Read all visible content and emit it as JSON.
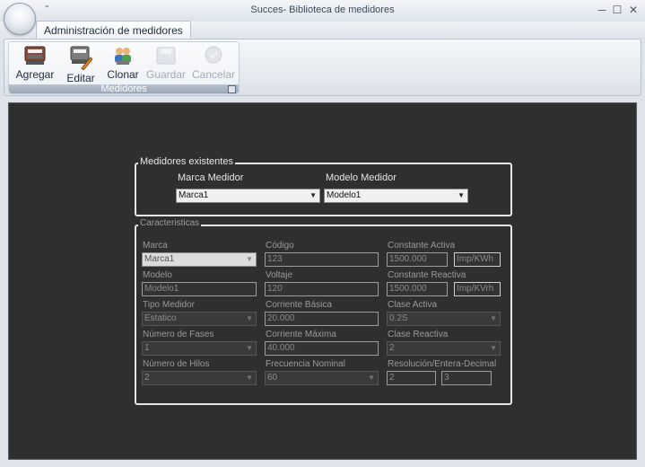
{
  "window": {
    "title": "Succes- Biblioteca de medidores",
    "qat_glyph": "⁼",
    "minimize_glyph": "─",
    "maximize_glyph": "☐",
    "close_glyph": "✕"
  },
  "ribbon": {
    "tab_label": "Administración de medidores",
    "group_label": "Medidores",
    "buttons": {
      "agregar": "Agregar",
      "editar": "Editar",
      "clonar": "Clonar",
      "guardar": "Guardar",
      "cancelar": "Cancelar"
    }
  },
  "existentes": {
    "legend": "Medidores existentes",
    "marca_label": "Marca Medidor",
    "marca_value": "Marca1",
    "modelo_label": "Modelo Medidor",
    "modelo_value": "Modelo1"
  },
  "caracteristicas": {
    "legend": "Caracteristicas",
    "marca_label": "Marca",
    "marca_value": "Marca1",
    "codigo_label": "Código",
    "codigo_value": "123",
    "const_activa_label": "Constante Activa",
    "const_activa_value": "1500.000",
    "const_activa_unit": "Imp/KWh",
    "modelo_label": "Modelo",
    "modelo_value": "Modelo1",
    "voltaje_label": "Voltaje",
    "voltaje_value": "120",
    "const_reactiva_label": "Constante Reactiva",
    "const_reactiva_value": "1500.000",
    "const_reactiva_unit": "Imp/KVrh",
    "tipo_label": "Tipo Medidor",
    "tipo_value": "Estatico",
    "corr_basica_label": "Corriente Básica",
    "corr_basica_value": "20.000",
    "clase_activa_label": "Clase Activa",
    "clase_activa_value": "0.2S",
    "fases_label": "Número de Fases",
    "fases_value": "1",
    "corr_max_label": "Corriente Máxima",
    "corr_max_value": "40.000",
    "clase_reactiva_label": "Clase Reactiva",
    "clase_reactiva_value": "2",
    "hilos_label": "Número de Hilos",
    "hilos_value": "2",
    "frecuencia_label": "Frecuencia Nominal",
    "frecuencia_value": "60",
    "resolucion_label": "Resolución/Entera-Decimal",
    "resolucion_entera": "2",
    "resolucion_decimal": "3"
  },
  "dropdown_arrow": "▼"
}
